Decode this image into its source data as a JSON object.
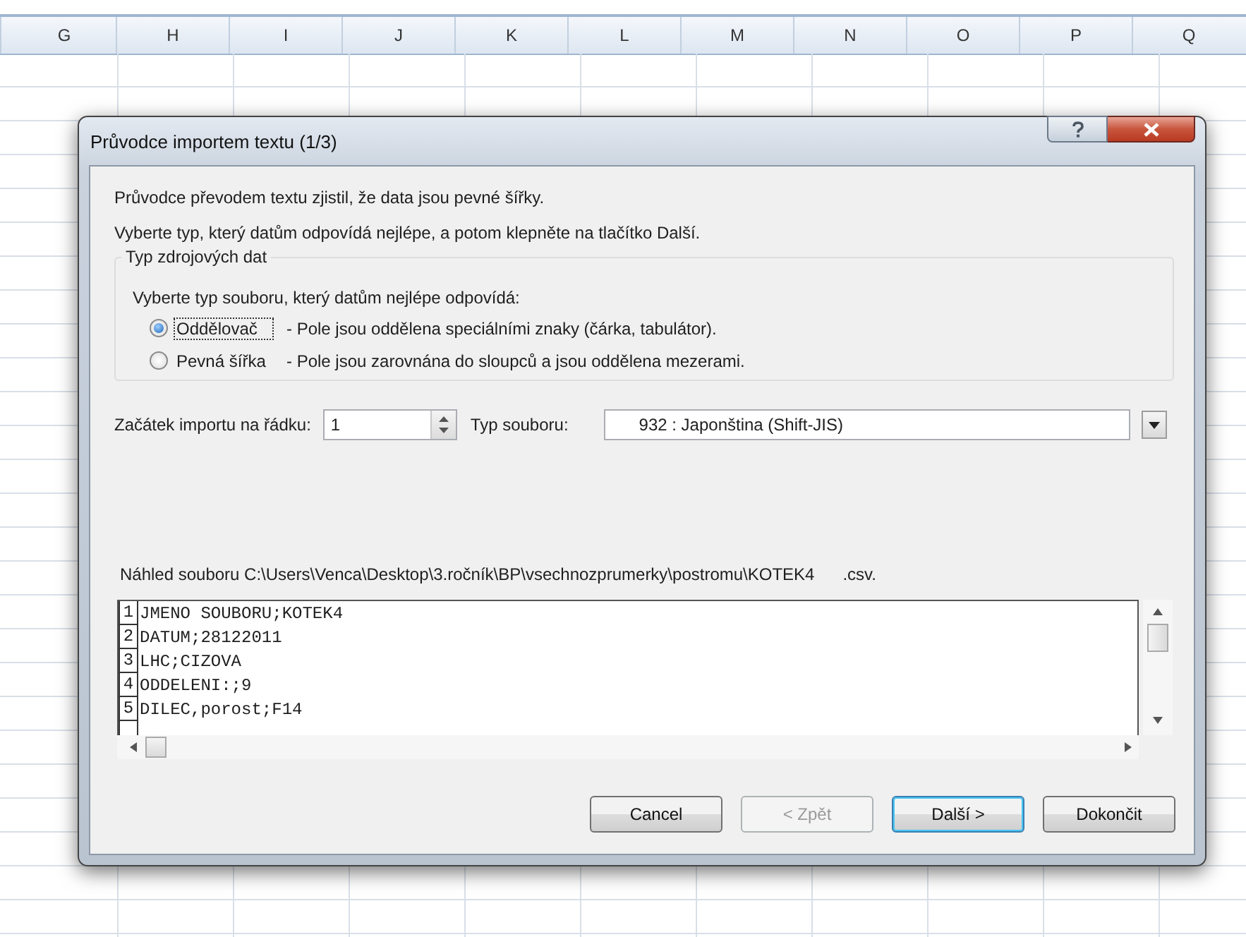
{
  "sheet": {
    "columns": [
      "G",
      "H",
      "I",
      "J",
      "K",
      "L",
      "M",
      "N",
      "O",
      "P",
      "Q"
    ]
  },
  "dialog": {
    "title": "Průvodce importem textu (1/3)",
    "intro": [
      "Průvodce převodem textu zjistil, že data jsou pevné šířky.",
      "Vyberte typ, který datům odpovídá nejlépe, a potom klepněte na tlačítko Další."
    ],
    "source_group": {
      "legend": "Typ zdrojových dat",
      "prompt": "Vyberte typ souboru, který datům nejlépe odpovídá:",
      "options": [
        {
          "label": "Oddělovač",
          "description": "- Pole jsou oddělena speciálními znaky (čárka, tabulátor).",
          "selected": true
        },
        {
          "label": "Pevná šířka",
          "description": "- Pole jsou zarovnána do sloupců a jsou oddělena mezerami.",
          "selected": false
        }
      ]
    },
    "start_row": {
      "label": "Začátek importu na řádku:",
      "value": "1"
    },
    "file_type": {
      "label": "Typ souboru:",
      "value": "932 : Japonština (Shift-JIS)"
    },
    "preview": {
      "label": "Náhled souboru C:\\Users\\Venca\\Desktop\\3.ročník\\BP\\vsechnozprumerky\\postromu\\KOTEK4      .csv.",
      "rows": [
        {
          "number": "1",
          "text": "JMENO SOUBORU;KOTEK4"
        },
        {
          "number": "2",
          "text": "DATUM;28122011"
        },
        {
          "number": "3",
          "text": "LHC;CIZOVA"
        },
        {
          "number": "4",
          "text": "ODDELENI:;9"
        },
        {
          "number": "5",
          "text": "DILEC,porost;F14"
        }
      ]
    },
    "buttons": [
      {
        "label": "Cancel",
        "disabled": false,
        "default": false
      },
      {
        "label": "< Zpět",
        "disabled": true,
        "default": false
      },
      {
        "label": "Další >",
        "disabled": false,
        "default": true
      },
      {
        "label": "Dokončit",
        "disabled": false,
        "default": false
      }
    ]
  }
}
